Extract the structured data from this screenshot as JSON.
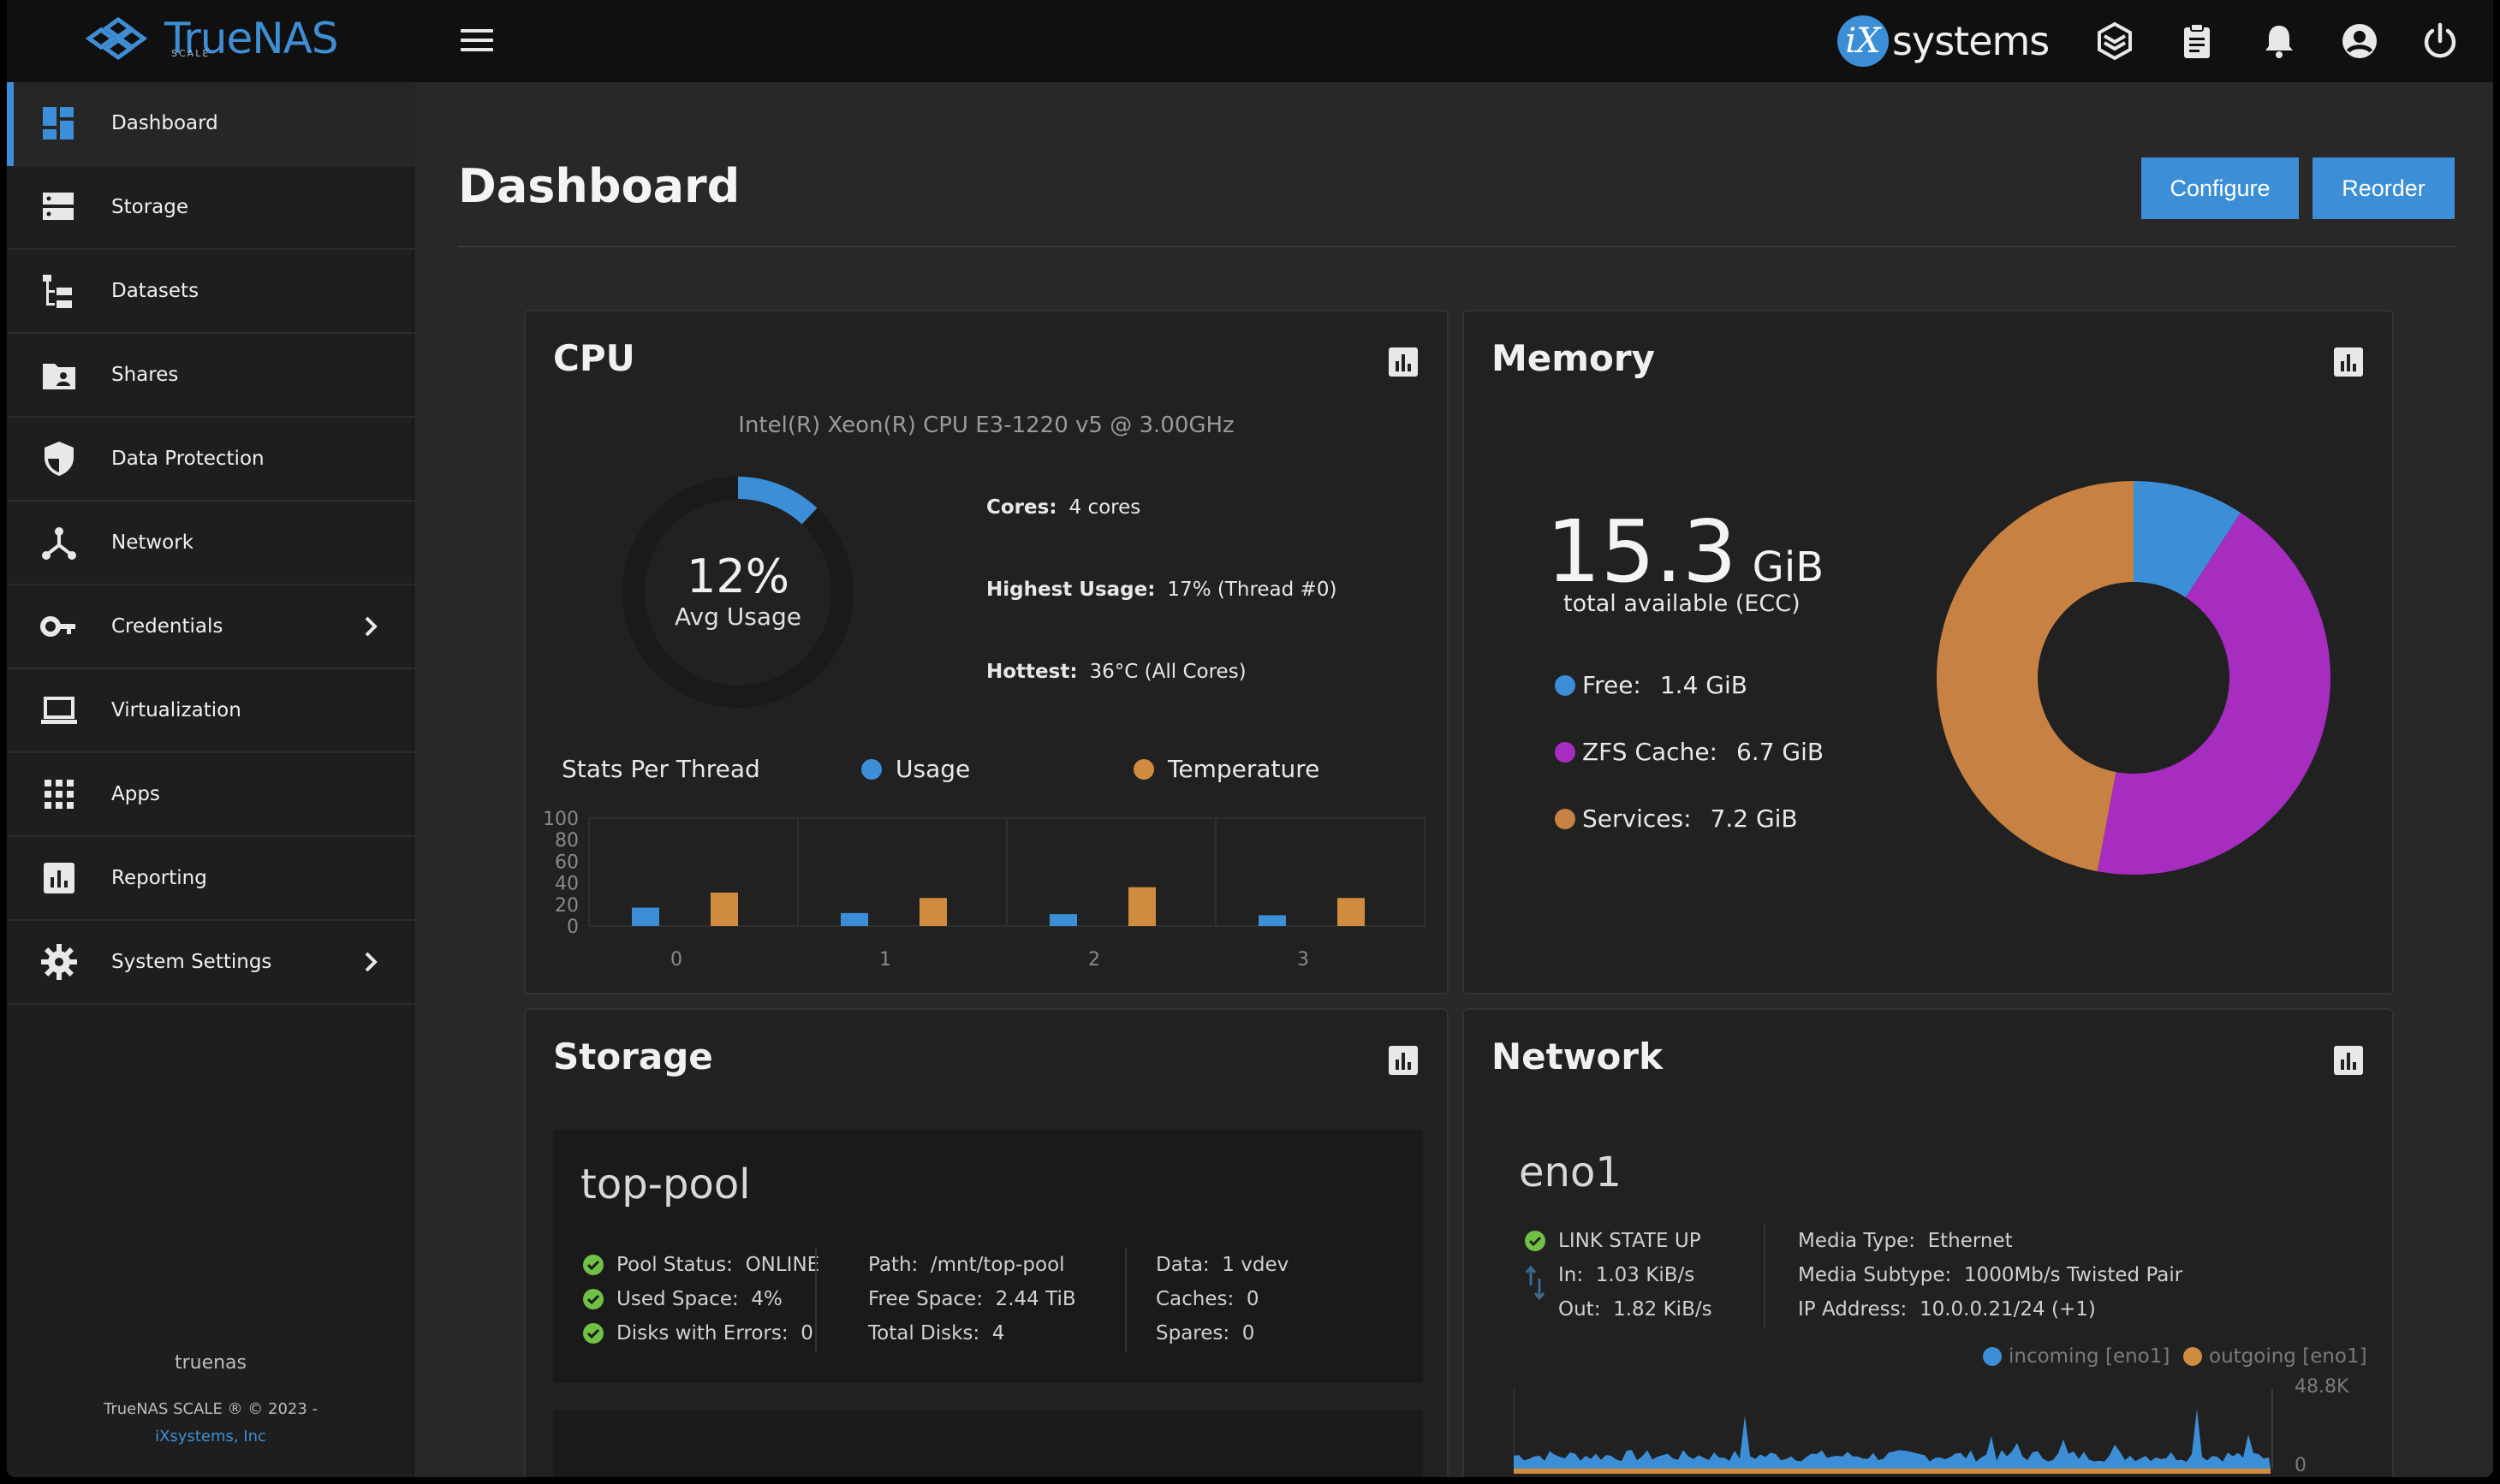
{
  "app": {
    "logo_text": "TrueNAS",
    "logo_sub": "SCALE",
    "brand_letter": "iX",
    "brand_text": "systems"
  },
  "sidebar": {
    "items": [
      {
        "label": "Dashboard",
        "icon": "dashboard-icon"
      },
      {
        "label": "Storage",
        "icon": "storage-icon"
      },
      {
        "label": "Datasets",
        "icon": "datasets-icon"
      },
      {
        "label": "Shares",
        "icon": "shares-icon"
      },
      {
        "label": "Data Protection",
        "icon": "shield-icon"
      },
      {
        "label": "Network",
        "icon": "network-icon"
      },
      {
        "label": "Credentials",
        "icon": "key-icon"
      },
      {
        "label": "Virtualization",
        "icon": "laptop-icon"
      },
      {
        "label": "Apps",
        "icon": "apps-grid-icon"
      },
      {
        "label": "Reporting",
        "icon": "reporting-icon"
      },
      {
        "label": "System Settings",
        "icon": "gear-icon"
      }
    ],
    "hostname": "truenas",
    "copyright": "TrueNAS SCALE ® © 2023 -",
    "company_link": "iXsystems, Inc"
  },
  "header": {
    "title": "Dashboard",
    "configure_label": "Configure",
    "reorder_label": "Reorder"
  },
  "cpu": {
    "title": "CPU",
    "model": "Intel(R) Xeon(R) CPU E3-1220 v5 @ 3.00GHz",
    "avg_usage_value": "12%",
    "avg_usage_fraction": 0.12,
    "avg_usage_label": "Avg Usage",
    "cores_label": "Cores:",
    "cores_value": "4 cores",
    "highest_label": "Highest Usage:",
    "highest_value": "17%  (Thread #0)",
    "hottest_label": "Hottest:",
    "hottest_value": "36°C  (All Cores)",
    "stats_label": "Stats Per Thread",
    "legend_usage": "Usage",
    "legend_temp": "Temperature",
    "colors": {
      "usage": "#3c8fd7",
      "temperature": "#d08b3e",
      "gauge_track": "#1a1a1a"
    }
  },
  "chart_data": {
    "type": "bar",
    "categories": [
      "0",
      "1",
      "2",
      "3"
    ],
    "y_ticks": [
      "100",
      "80",
      "60",
      "40",
      "20",
      "0"
    ],
    "ylim": [
      0,
      100
    ],
    "series": [
      {
        "name": "Usage",
        "values": [
          17,
          12,
          11,
          10
        ]
      },
      {
        "name": "Temperature",
        "values": [
          31,
          26,
          36,
          26
        ]
      }
    ]
  },
  "memory": {
    "title": "Memory",
    "total_value": "15.3",
    "total_unit": "GiB",
    "total_label": "total available (ECC)",
    "items": [
      {
        "label": "Free:",
        "value": "1.4 GiB",
        "gib": 1.4,
        "color": "#3c8fd7"
      },
      {
        "label": "ZFS Cache:",
        "value": "6.7 GiB",
        "gib": 6.7,
        "color": "#a72cc0"
      },
      {
        "label": "Services:",
        "value": "7.2 GiB",
        "gib": 7.2,
        "color": "#c78243"
      }
    ]
  },
  "storage": {
    "title": "Storage",
    "pool_name": "top-pool",
    "status_label": "Pool Status:",
    "status_value": "ONLINE",
    "used_label": "Used Space:",
    "used_value": "4%",
    "errors_label": "Disks with Errors:",
    "errors_value": "0",
    "path_label": "Path:",
    "path_value": "/mnt/top-pool",
    "free_label": "Free Space:",
    "free_value": "2.44 TiB",
    "total_label": "Total Disks:",
    "total_value": "4",
    "data_label": "Data:",
    "data_value": "1 vdev",
    "caches_label": "Caches:",
    "caches_value": "0",
    "spares_label": "Spares:",
    "spares_value": "0"
  },
  "network": {
    "title": "Network",
    "interface": "eno1",
    "link_state": "LINK STATE UP",
    "in_label": "In:",
    "in_value": "1.03 KiB/s",
    "out_label": "Out:",
    "out_value": "1.82 KiB/s",
    "media_type_label": "Media Type:",
    "media_type_value": "Ethernet",
    "media_subtype_label": "Media Subtype:",
    "media_subtype_value": "1000Mb/s Twisted Pair",
    "ip_label": "IP Address:",
    "ip_value": "10.0.0.21/24 (+1)",
    "legend_in": "incoming [eno1]",
    "legend_out": "outgoing [eno1]",
    "y_max_label": "48.8K",
    "y_min_label": "0",
    "colors": {
      "incoming": "#3c8fd7",
      "outgoing": "#d08b3e"
    }
  }
}
